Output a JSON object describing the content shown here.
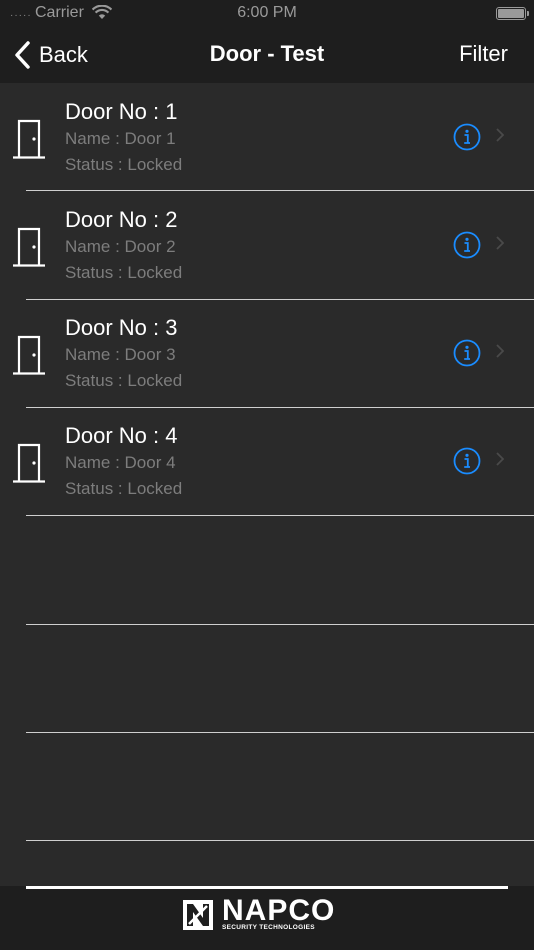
{
  "status_bar": {
    "carrier": "Carrier",
    "time": "6:00 PM",
    "signal_icon": "signal-dots-icon",
    "wifi_icon": "wifi-icon",
    "battery_icon": "battery-icon"
  },
  "nav": {
    "back_label": "Back",
    "title": "Door - Test",
    "filter_label": "Filter"
  },
  "doors": [
    {
      "door_no": "Door No : 1",
      "name": "Name : Door 1",
      "status": "Status : Locked"
    },
    {
      "door_no": "Door No : 2",
      "name": "Name : Door 2",
      "status": "Status : Locked"
    },
    {
      "door_no": "Door No : 3",
      "name": "Name : Door 3",
      "status": "Status : Locked"
    },
    {
      "door_no": "Door No : 4",
      "name": "Name : Door 4",
      "status": "Status : Locked"
    }
  ],
  "footer": {
    "logo_word": "NAPCO",
    "logo_sub": "SECURITY TECHNOLOGIES"
  },
  "colors": {
    "background": "#2a2a2a",
    "bar": "#1e1e1e",
    "accent": "#1a8cff",
    "secondary_text": "#7d7d7d"
  }
}
